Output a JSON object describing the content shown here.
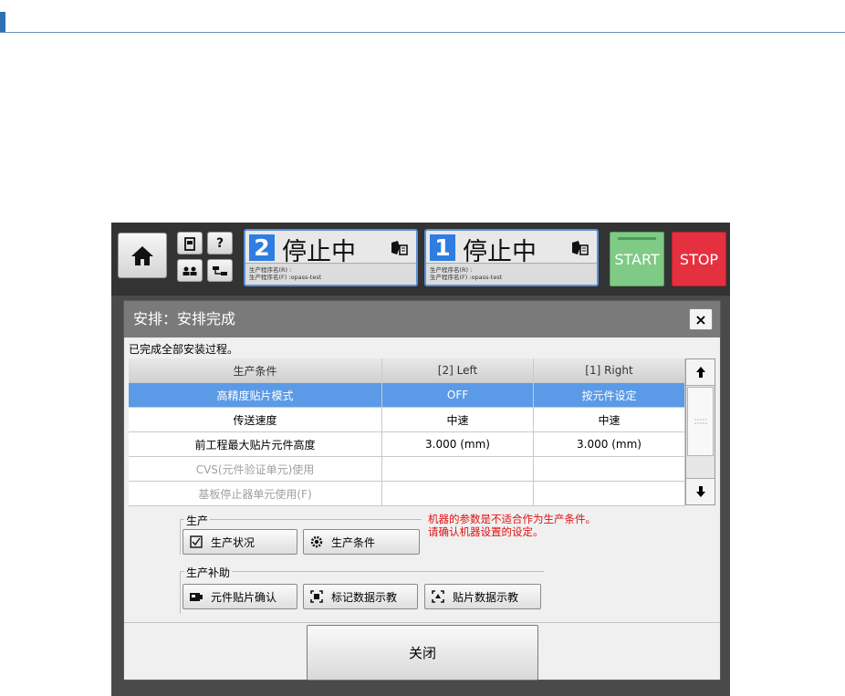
{
  "toolbar": {
    "lane2": {
      "num": "2",
      "status": "停止中",
      "prog_r": "生产程序名(R) :",
      "prog_f": "生产程序名(F) :opass-test"
    },
    "lane1": {
      "num": "1",
      "status": "停止中",
      "prog_r": "生产程序名(R) :",
      "prog_f": "生产程序名(F) :opass-test"
    },
    "help": "?",
    "start": "START",
    "stop": "STOP"
  },
  "dialog": {
    "title": "安排：安排完成",
    "close_x": "×",
    "message": "已完成全部安装过程。",
    "table": {
      "headers": [
        "生产条件",
        "[2] Left",
        "[1] Right"
      ],
      "rows": [
        [
          "高精度贴片模式",
          "OFF",
          "按元件设定"
        ],
        [
          "传送速度",
          "中速",
          "中速"
        ],
        [
          "前工程最大贴片元件高度",
          "3.000 (mm)",
          "3.000 (mm)"
        ],
        [
          "CVS(元件验证单元)使用",
          "",
          ""
        ],
        [
          "基板停止器单元使用(F)",
          "",
          ""
        ]
      ],
      "selected_row": 0
    },
    "production_group": {
      "label": "生产",
      "status_btn": "生产状况",
      "conditions_btn": "生产条件"
    },
    "warning": [
      "机器的参数是不适合作为生产条件。",
      "请确认机器设置的设定。"
    ],
    "assist_group": {
      "label": "生产补助",
      "part_confirm": "元件贴片确认",
      "mark_teach": "标记数据示教",
      "place_teach": "贴片数据示教"
    },
    "close_button": "关闭"
  },
  "colors": {
    "accent": "#2f7de1",
    "selected_row": "#5b9ae6",
    "start": "#7fca85",
    "stop": "#e53040",
    "warning": "#e01010"
  }
}
